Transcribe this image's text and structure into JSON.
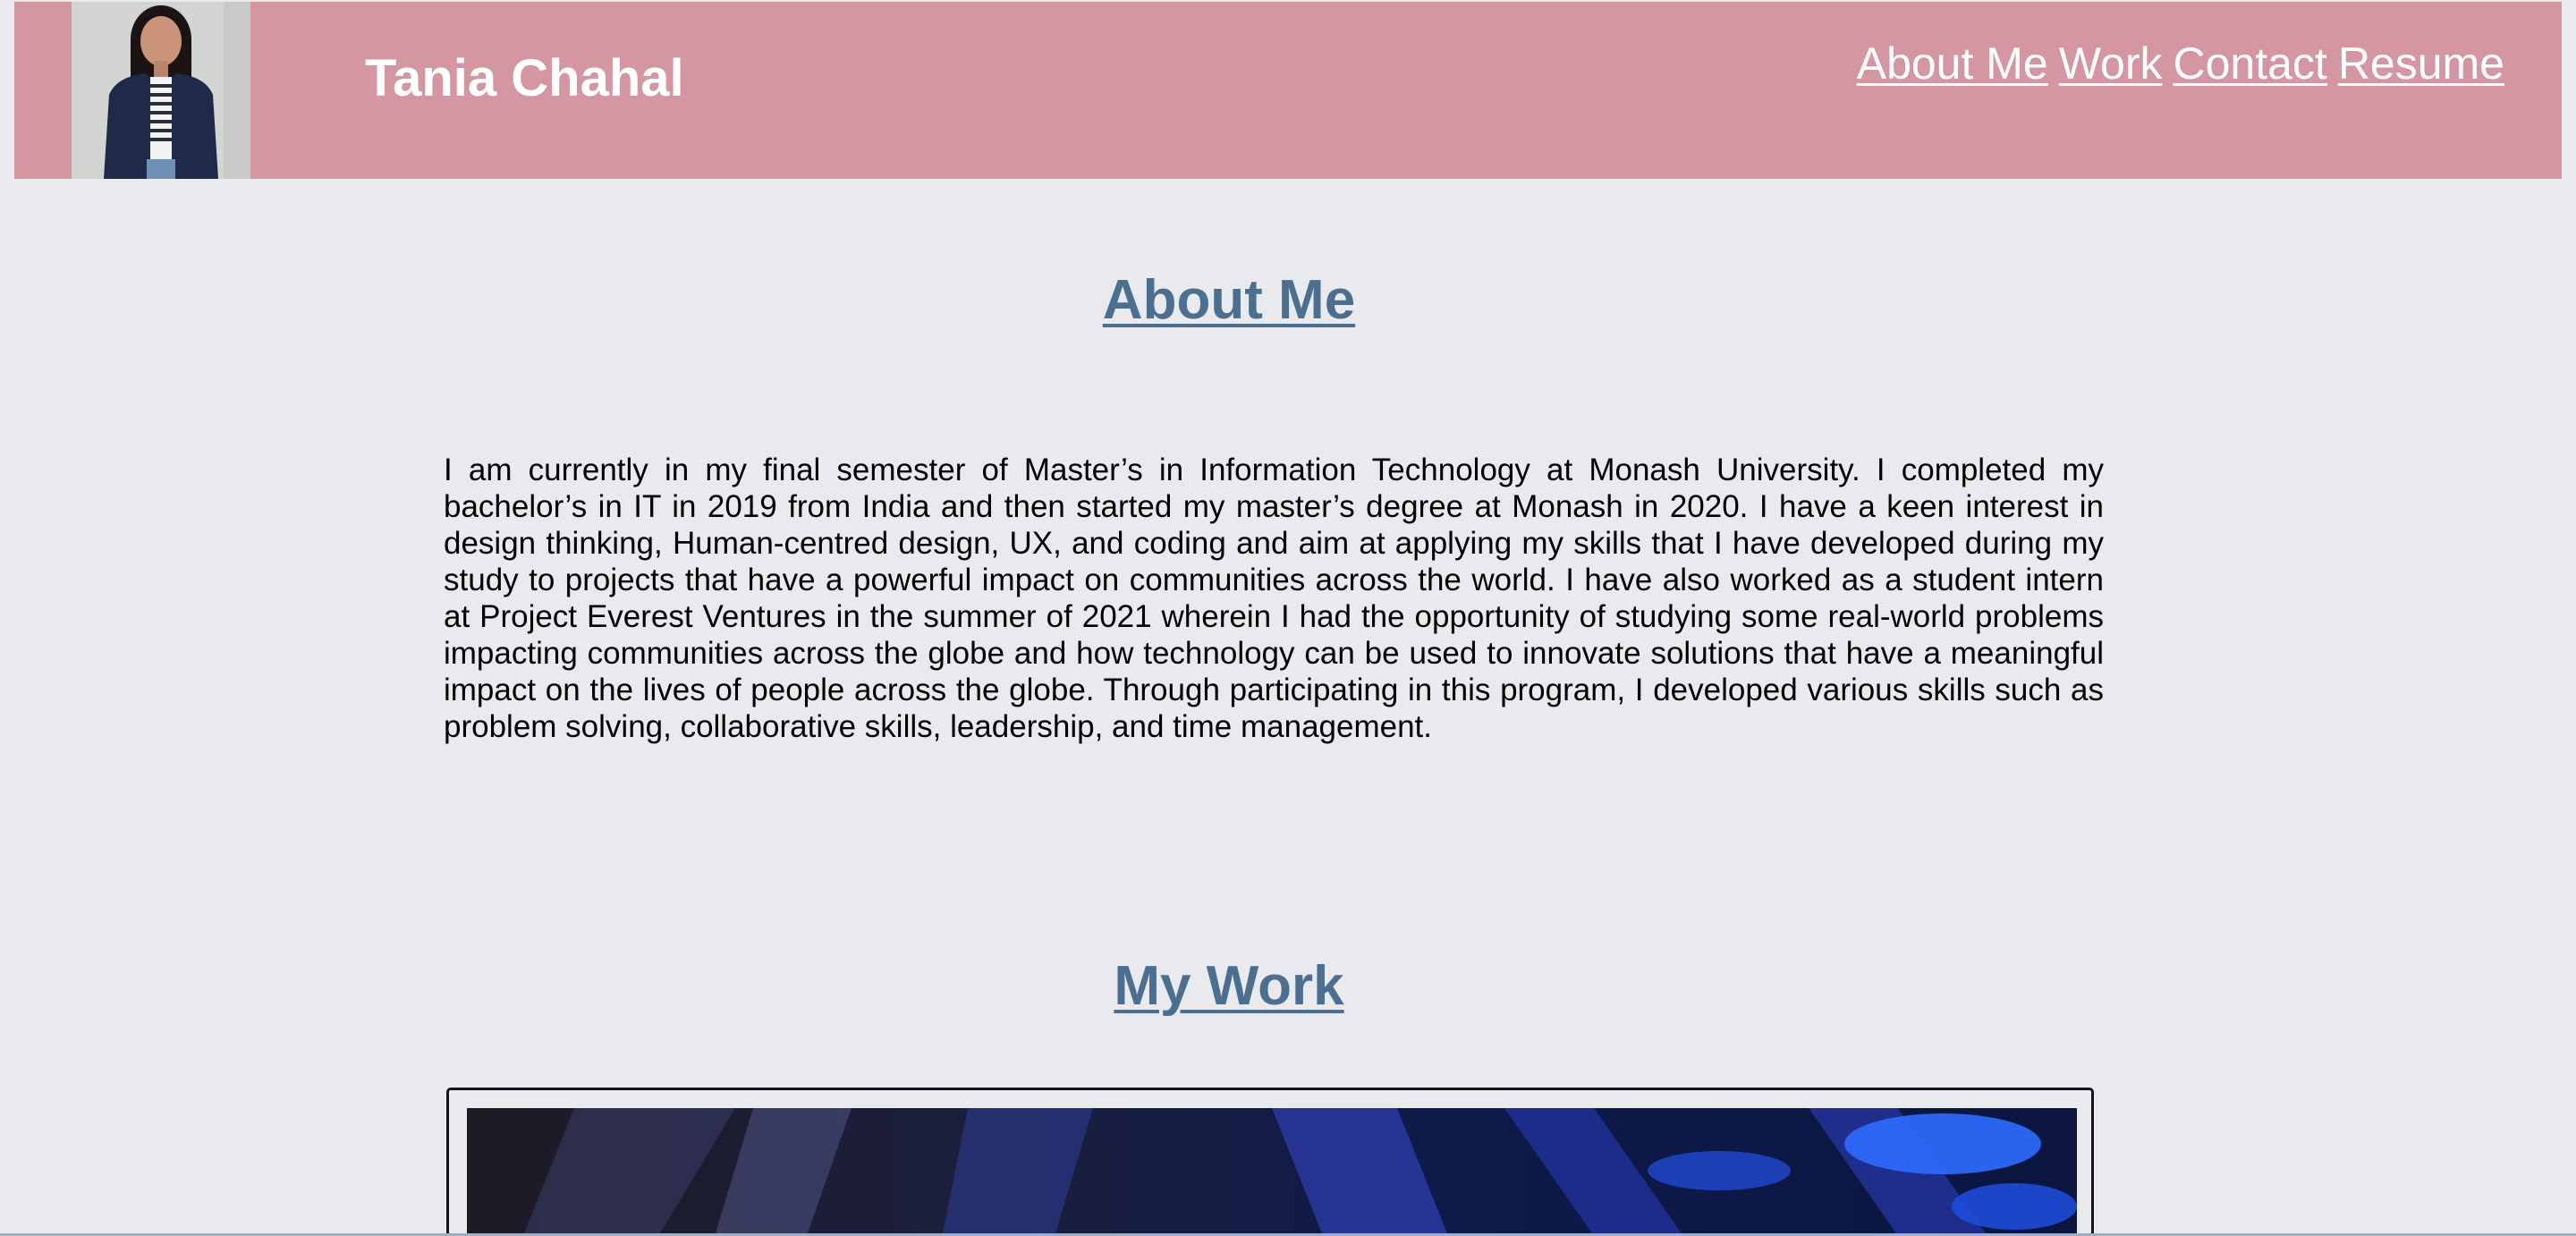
{
  "header": {
    "name": "Tania Chahal",
    "nav": [
      {
        "label": "About Me"
      },
      {
        "label": "Work"
      },
      {
        "label": "Contact"
      },
      {
        "label": "Resume"
      }
    ]
  },
  "about": {
    "title": "About Me",
    "text": "I am currently in my final semester of Master’s in Information Technology at Monash University. I completed my bachelor’s in IT in 2019 from India and then started my master’s degree at Monash in 2020. I have a keen interest in design thinking, Human-centred design, UX, and coding and aim at applying my skills that I have developed during my study to projects that have a powerful impact on communities across the world. I have also worked as a student intern at Project Everest Ventures in the summer of 2021 wherein I had the opportunity of studying some real-world problems impacting communities across the globe and how technology can be used to innovate solutions that have a meaningful impact on the lives of people across the globe. Through participating in this program, I developed various skills such as problem solving, collaborative skills, leadership, and time management."
  },
  "work": {
    "title": "My Work"
  },
  "colors": {
    "header_bg": "#d497a1",
    "page_bg": "#e9eaee",
    "heading": "#4c6f8f",
    "nav_text": "#ffffff"
  }
}
